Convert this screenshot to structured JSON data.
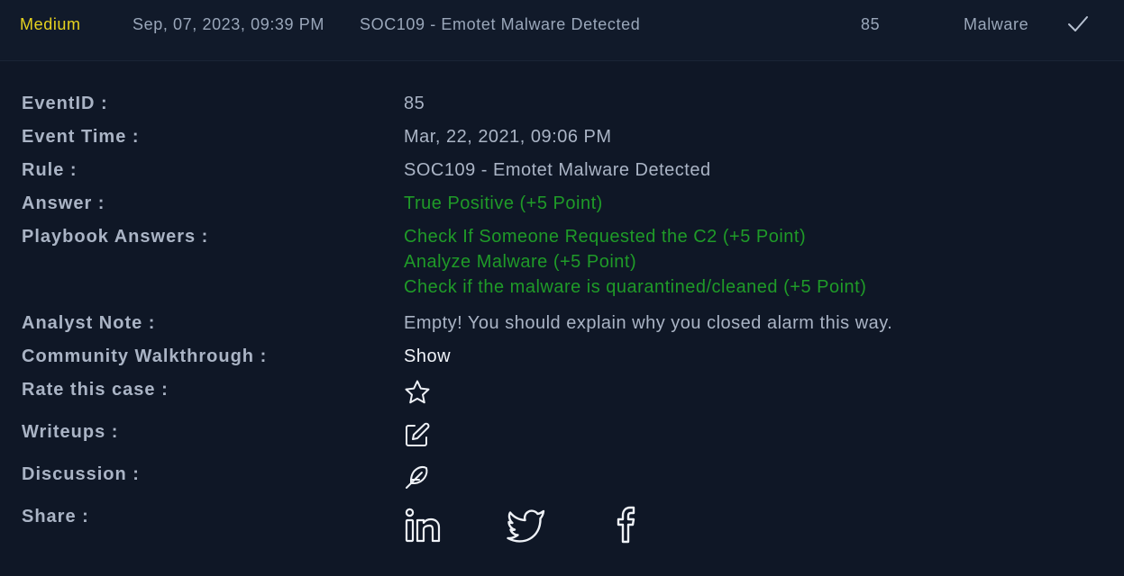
{
  "alert": {
    "severity": "Medium",
    "date": "Sep, 07, 2023, 09:39 PM",
    "rule": "SOC109 - Emotet Malware Detected",
    "event_id": "85",
    "type": "Malware"
  },
  "details": {
    "event_id_label": "EventID :",
    "event_id_value": "85",
    "event_time_label": "Event Time :",
    "event_time_value": "Mar, 22, 2021, 09:06 PM",
    "rule_label": "Rule :",
    "rule_value": "SOC109 - Emotet Malware Detected",
    "answer_label": "Answer :",
    "answer_value": "True Positive (+5 Point)",
    "playbook_label": "Playbook Answers :",
    "playbook_answers": [
      "Check If Someone Requested the C2 (+5 Point)",
      "Analyze Malware (+5 Point)",
      "Check if the malware is quarantined/cleaned (+5 Point)"
    ],
    "analyst_note_label": "Analyst Note :",
    "analyst_note_value": "Empty! You should explain why you closed alarm this way.",
    "walkthrough_label": "Community Walkthrough :",
    "walkthrough_value": "Show",
    "rate_label": "Rate this case :",
    "writeups_label": "Writeups :",
    "discussion_label": "Discussion :",
    "share_label": "Share :"
  },
  "icons": {
    "status": "check-icon",
    "rate": "star-icon",
    "writeups": "edit-icon",
    "discussion": "feather-icon",
    "share": [
      "linkedin-icon",
      "twitter-icon",
      "facebook-icon"
    ]
  },
  "colors": {
    "background": "#0f1726",
    "severity_medium": "#e6d21f",
    "correct": "#1f9b28",
    "label": "#aab4c5"
  }
}
